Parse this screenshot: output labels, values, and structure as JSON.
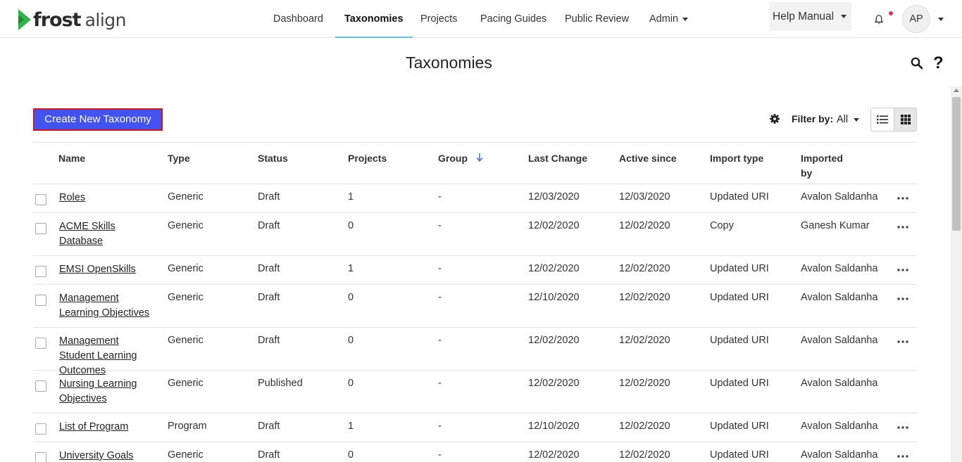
{
  "brand": {
    "name_bold": "frost",
    "name_light": "align",
    "accent": "#2fb44a"
  },
  "nav": {
    "items": [
      {
        "label": "Dashboard"
      },
      {
        "label": "Taxonomies",
        "active": true
      },
      {
        "label": "Projects"
      },
      {
        "label": "Pacing Guides"
      },
      {
        "label": "Public Review"
      },
      {
        "label": "Admin",
        "dropdown": true
      }
    ],
    "help_manual": "Help Manual",
    "avatar_initials": "AP"
  },
  "page": {
    "title": "Taxonomies"
  },
  "toolbar": {
    "create_label": "Create New Taxonomy",
    "filter_label": "Filter by:",
    "filter_value": "All"
  },
  "table": {
    "columns": {
      "name": "Name",
      "type": "Type",
      "status": "Status",
      "projects": "Projects",
      "group": "Group",
      "last_change": "Last Change",
      "active_since": "Active since",
      "import_type": "Import type",
      "imported_by_1": "Imported",
      "imported_by_2": "by"
    },
    "rows": [
      {
        "name": "Roles",
        "type": "Generic",
        "status": "Draft",
        "projects": "1",
        "group": "-",
        "last_change": "12/03/2020",
        "active_since": "12/03/2020",
        "import_type": "Updated URI",
        "imported_by": "Avalon Saldanha",
        "more": true
      },
      {
        "name": "ACME Skills Database",
        "type": "Generic",
        "status": "Draft",
        "projects": "0",
        "group": "-",
        "last_change": "12/02/2020",
        "active_since": "12/02/2020",
        "import_type": "Copy",
        "imported_by": "Ganesh Kumar",
        "more": true
      },
      {
        "name": "EMSI OpenSkills",
        "type": "Generic",
        "status": "Draft",
        "projects": "1",
        "group": "-",
        "last_change": "12/02/2020",
        "active_since": "12/02/2020",
        "import_type": "Updated URI",
        "imported_by": "Avalon Saldanha",
        "more": true
      },
      {
        "name": "Management Learning Objectives",
        "type": "Generic",
        "status": "Draft",
        "projects": "0",
        "group": "-",
        "last_change": "12/10/2020",
        "active_since": "12/02/2020",
        "import_type": "Updated URI",
        "imported_by": "Avalon Saldanha",
        "more": true
      },
      {
        "name": "Management Student Learning Outcomes",
        "type": "Generic",
        "status": "Draft",
        "projects": "0",
        "group": "-",
        "last_change": "12/02/2020",
        "active_since": "12/02/2020",
        "import_type": "Updated URI",
        "imported_by": "Avalon Saldanha",
        "more": true
      },
      {
        "name": "Nursing Learning Objectives",
        "type": "Generic",
        "status": "Published",
        "projects": "0",
        "group": "-",
        "last_change": "12/02/2020",
        "active_since": "12/02/2020",
        "import_type": "Updated URI",
        "imported_by": "Avalon Saldanha",
        "more": false
      },
      {
        "name": "List of Program",
        "type": "Program",
        "status": "Draft",
        "projects": "1",
        "group": "-",
        "last_change": "12/10/2020",
        "active_since": "12/02/2020",
        "import_type": "Updated URI",
        "imported_by": "Avalon Saldanha",
        "more": true
      },
      {
        "name": "University Goals",
        "type": "Generic",
        "status": "Draft",
        "projects": "0",
        "group": "-",
        "last_change": "12/02/2020",
        "active_since": "12/02/2020",
        "import_type": "Updated URI",
        "imported_by": "Avalon Saldanha",
        "more": true
      }
    ]
  }
}
